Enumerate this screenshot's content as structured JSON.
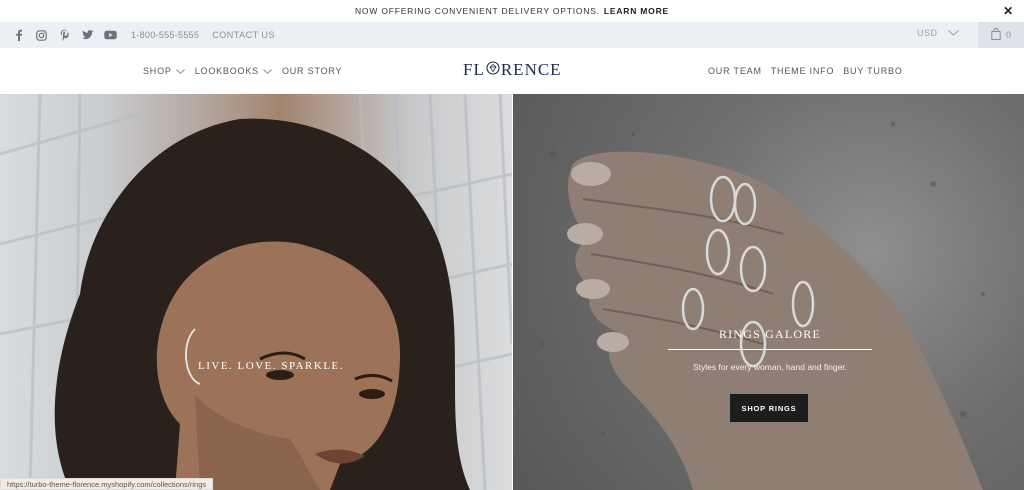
{
  "announcement": {
    "text": "NOW OFFERING CONVENIENT DELIVERY OPTIONS.",
    "link": "LEARN MORE",
    "close": "✕"
  },
  "utility": {
    "social_icons": [
      "facebook-icon",
      "instagram-icon",
      "pinterest-icon",
      "twitter-icon",
      "youtube-icon"
    ],
    "phone": "1-800-555-5555",
    "contact": "CONTACT US",
    "currency": "USD",
    "cart_count": "0"
  },
  "nav": {
    "logo": "FL RENCE",
    "logo_letters": {
      "pre": "FL",
      "post": "RENCE"
    },
    "left": [
      {
        "label": "SHOP",
        "dropdown": true
      },
      {
        "label": "LOOKBOOKS",
        "dropdown": true
      },
      {
        "label": "OUR STORY",
        "dropdown": false
      }
    ],
    "right": [
      "OUR TEAM",
      "THEME INFO",
      "BUY TURBO"
    ]
  },
  "hero": {
    "left_tagline": "LIVE. LOVE. SPARKLE.",
    "right_title": "RINGS GALORE",
    "right_subtitle": "Styles for every woman, hand and finger.",
    "right_button": "SHOP RINGS"
  },
  "status_url": "https://turbo-theme-florence.myshopify.com/collections/rings",
  "colors": {
    "utility_bg": "#eceff3",
    "logo": "#1f2a4c",
    "button_bg": "#1d1d1d"
  }
}
